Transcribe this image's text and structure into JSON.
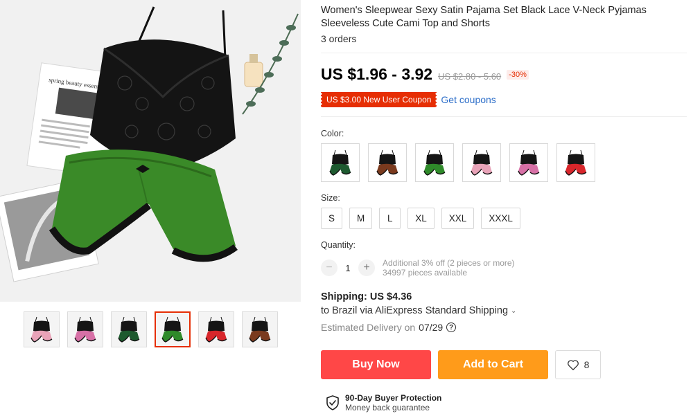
{
  "product": {
    "title": "Women's Sleepwear Sexy Satin Pajama Set Black Lace V-Neck Pyjamas Sleeveless Cute Cami Top and Shorts",
    "orders": "3 orders"
  },
  "main_image": {
    "magazine_heading": "spring beauty essentials"
  },
  "thumbnails": [
    {
      "name": "pink",
      "color": "#e8a3b8",
      "active": false
    },
    {
      "name": "rose",
      "color": "#d770a6",
      "active": false
    },
    {
      "name": "dark-green",
      "color": "#1d5a2e",
      "active": false
    },
    {
      "name": "green",
      "color": "#2f8a2a",
      "active": true
    },
    {
      "name": "red",
      "color": "#d8262b",
      "active": false
    },
    {
      "name": "brown",
      "color": "#7a3a1e",
      "active": false
    }
  ],
  "price": {
    "current": "US $1.96 - 3.92",
    "original": "US $2.80 - 5.60",
    "discount": "-30%"
  },
  "coupon": {
    "badge": "US $3.00 New User Coupon",
    "link": "Get coupons"
  },
  "color_section": {
    "label": "Color:",
    "options": [
      {
        "name": "dark-green",
        "color": "#1e5a30"
      },
      {
        "name": "brown",
        "color": "#7a3a1e"
      },
      {
        "name": "green",
        "color": "#2f8a2a"
      },
      {
        "name": "pink",
        "color": "#e8a3b8"
      },
      {
        "name": "rose",
        "color": "#d770a6"
      },
      {
        "name": "red",
        "color": "#d8262b"
      }
    ]
  },
  "size_section": {
    "label": "Size:",
    "options": [
      "S",
      "M",
      "L",
      "XL",
      "XXL",
      "XXXL"
    ]
  },
  "quantity": {
    "label": "Quantity:",
    "minus": "−",
    "value": "1",
    "plus": "+",
    "offer": "Additional 3% off (2 pieces or more)",
    "available": "34997 pieces available"
  },
  "shipping": {
    "title": "Shipping: US $4.36",
    "destination": "to Brazil via AliExpress Standard Shipping",
    "delivery_prefix": "Estimated Delivery on",
    "delivery_date": "07/29"
  },
  "actions": {
    "buy_now": "Buy Now",
    "add_to_cart": "Add to Cart",
    "wishlist_count": "8"
  },
  "protection": {
    "title": "90-Day Buyer Protection",
    "subtitle": "Money back guarantee"
  },
  "colors": {
    "accent_red": "#ff4747",
    "accent_orange": "#ff9b1a",
    "coupon_red": "#e62e04",
    "link_blue": "#2e6fc9"
  }
}
